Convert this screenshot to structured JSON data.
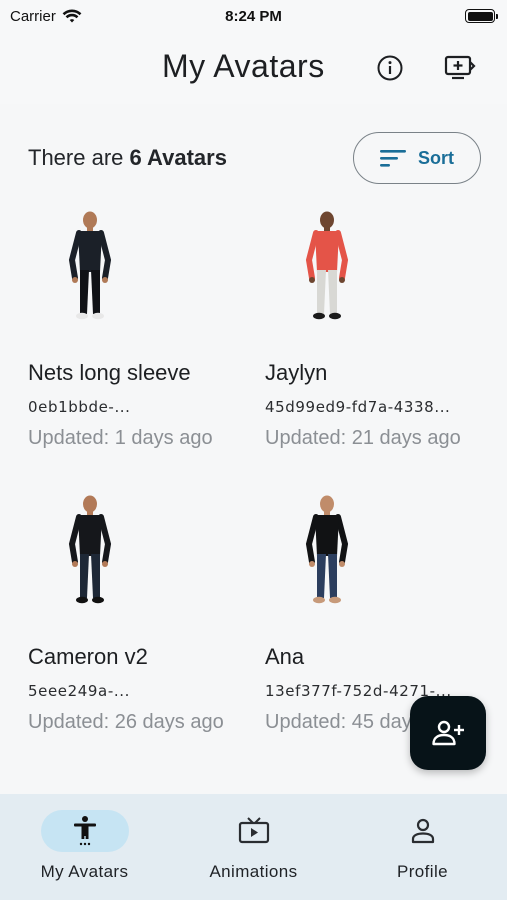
{
  "status_bar": {
    "carrier": "Carrier",
    "time": "8:24 PM",
    "battery_level": 1.0
  },
  "header": {
    "title": "My Avatars",
    "info_icon": "info-icon",
    "add_screen_icon": "add-to-screen-icon"
  },
  "summary": {
    "prefix": "There are ",
    "count_label": "6 Avatars"
  },
  "sort": {
    "label": "Sort",
    "icon": "sort-icon"
  },
  "avatars": [
    {
      "name": "Nets long sleeve",
      "id": "0eb1bbde-...",
      "updated": "Updated: 1 days ago",
      "shirt": "#1b2028",
      "pants": "#101216",
      "skin": "#b07a57",
      "shoes": "#e8e8e8"
    },
    {
      "name": "Jaylyn",
      "id": "45d99ed9-fd7a-4338...",
      "updated": "Updated: 21 days ago",
      "shirt": "#e45448",
      "pants": "#d8d8d4",
      "skin": "#6e4630",
      "shoes": "#1b1b1b"
    },
    {
      "name": "Cameron v2",
      "id": "5eee249a-...",
      "updated": "Updated: 26 days ago",
      "shirt": "#15171b",
      "pants": "#1e2836",
      "skin": "#b27a58",
      "shoes": "#121212"
    },
    {
      "name": "Ana",
      "id": "13ef377f-752d-4271-...",
      "updated": "Updated: 45 days ago",
      "shirt": "#111214",
      "pants": "#2c3e5e",
      "skin": "#c08c6a",
      "shoes": "#c79a7a"
    }
  ],
  "fab": {
    "icon": "add-person-icon"
  },
  "bottom_nav": {
    "items": [
      {
        "label": "My Avatars",
        "icon": "person-standing-icon",
        "active": true
      },
      {
        "label": "Animations",
        "icon": "tv-play-icon",
        "active": false
      },
      {
        "label": "Profile",
        "icon": "person-outline-icon",
        "active": false
      }
    ]
  },
  "colors": {
    "accent": "#1a6e98",
    "nav_background": "#e3ecf2",
    "nav_active_pill": "#c6e4f3",
    "fab": "#071318",
    "muted_text": "#8b8f94"
  }
}
